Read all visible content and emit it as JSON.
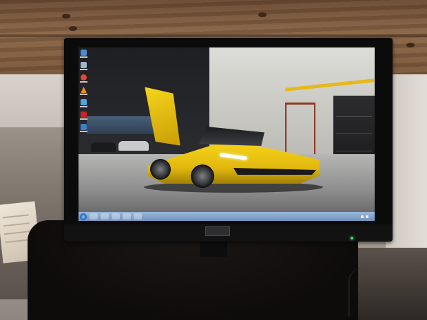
{
  "scene": {
    "description_tags": [
      "photo",
      "monitor",
      "desk"
    ]
  },
  "monitor": {
    "brand_label": "",
    "power_led_color": "#3fe05a",
    "wallpaper": {
      "car_color": "#f4d21a",
      "accent_stripe_color": "#e6b91b"
    }
  },
  "desktop": {
    "icons": [
      {
        "name": "computer-icon",
        "color": "#4a8ad4"
      },
      {
        "name": "recycle-bin-icon",
        "color": "#9fb5c8"
      },
      {
        "name": "chrome-icon",
        "color": "#e0493a"
      },
      {
        "name": "vlc-icon",
        "color": "#f08a1c"
      },
      {
        "name": "app-icon",
        "color": "#4fa3e0"
      },
      {
        "name": "pdf-icon",
        "color": "#c8242b"
      },
      {
        "name": "folder-icon",
        "color": "#3a7fd0"
      }
    ],
    "taskbar": {
      "pinned": [
        "ie-icon",
        "explorer-icon",
        "media-icon",
        "chrome-icon",
        "app-icon"
      ],
      "clock_time": "",
      "clock_date": ""
    }
  }
}
